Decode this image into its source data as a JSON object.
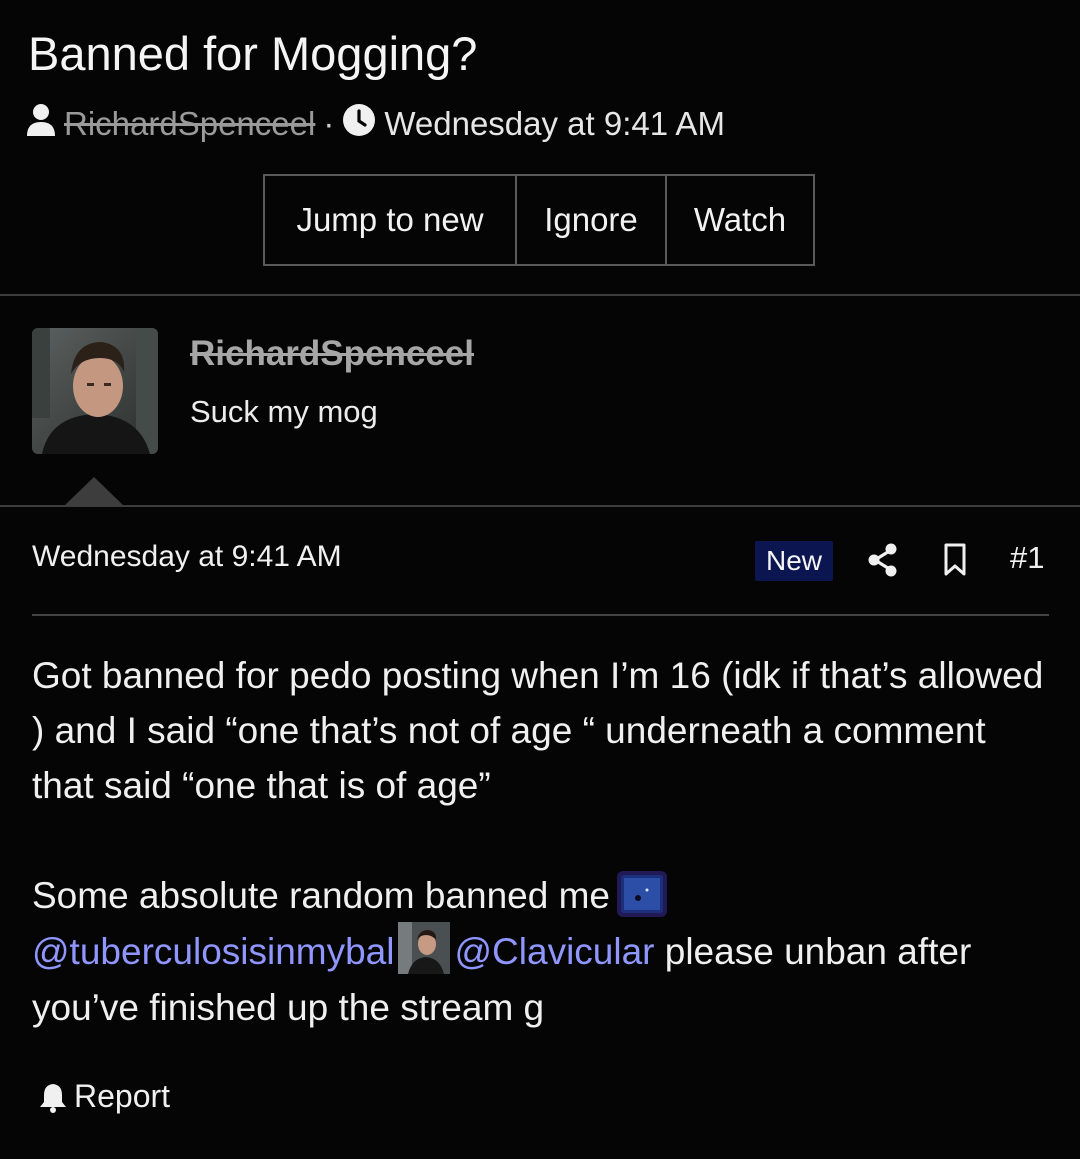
{
  "thread": {
    "title": "Banned for Mogging?",
    "author": "RichardSpenceel",
    "separator": "·",
    "date": "Wednesday at 9:41 AM"
  },
  "actions": [
    "Jump to new",
    "Ignore",
    "Watch"
  ],
  "poster": {
    "name": "RichardSpenceel",
    "user_title": "Suck my mog"
  },
  "post": {
    "date": "Wednesday at 9:41 AM",
    "badge": "New",
    "number": "#1",
    "paragraph1": "Got banned for pedo posting when I’m 16 (idk if that’s allowed ) and I said “one that’s not of age “ underneath a comment that said “one that is of age”",
    "paragraph2_start": "Some absolute random banned me",
    "mention1": "@tuberculosisinmybal",
    "mention2": "@Clavicular",
    "paragraph2_end": " please unban after you’ve finished up the stream g"
  },
  "footer": {
    "report_label": "Report"
  },
  "colors": {
    "mention": "#8f96ff",
    "badge_bg": "#0b1650",
    "background": "#050505"
  },
  "icons": [
    "user-icon",
    "clock-icon",
    "share-icon",
    "bookmark-icon",
    "bell-icon"
  ]
}
